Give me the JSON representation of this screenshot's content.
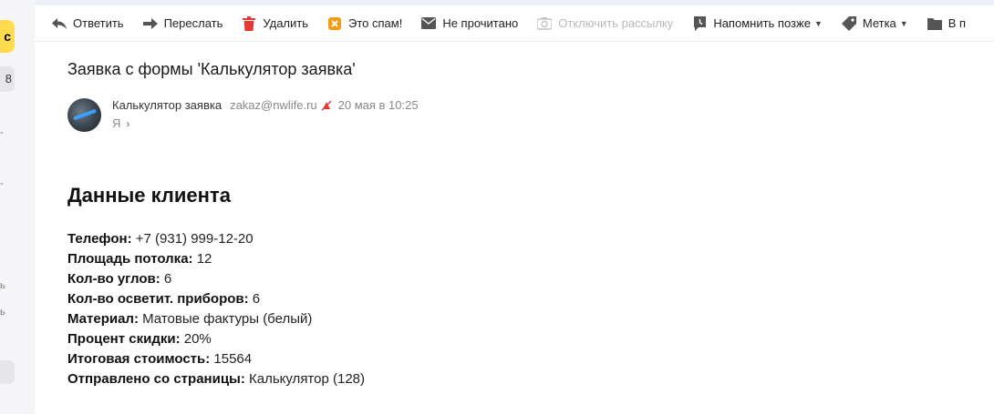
{
  "sidebar": {
    "compose_glyph": "с",
    "count": "8",
    "marks": [
      "-",
      "-",
      "ь",
      "ь"
    ]
  },
  "toolbar": {
    "items": [
      {
        "label": "Ответить",
        "icon": "reply-icon",
        "disabled": false
      },
      {
        "label": "Переслать",
        "icon": "forward-icon",
        "disabled": false
      },
      {
        "label": "Удалить",
        "icon": "trash-icon",
        "disabled": false
      },
      {
        "label": "Это спам!",
        "icon": "spam-icon",
        "disabled": false
      },
      {
        "label": "Не прочитано",
        "icon": "envelope-icon",
        "disabled": false
      },
      {
        "label": "Отключить рассылку",
        "icon": "unsubscribe-icon",
        "disabled": true
      },
      {
        "label": "Напомнить позже",
        "icon": "reminder-icon",
        "disabled": false,
        "dropdown": true
      },
      {
        "label": "Метка",
        "icon": "tag-icon",
        "disabled": false,
        "dropdown": true
      },
      {
        "label": "В п",
        "icon": "folder-icon",
        "disabled": false
      }
    ],
    "colors": {
      "trash": "#e53935",
      "spam": "#f39c12",
      "icon": "#555555"
    }
  },
  "message": {
    "subject": "Заявка с формы 'Калькулятор заявка'",
    "sender_name": "Калькулятор заявка",
    "sender_email": "zakaz@nwlife.ru",
    "date": "20 мая в 10:25",
    "recipient": "Я",
    "heading": "Данные клиента",
    "fields": [
      {
        "label": "Телефон:",
        "value": " +7 (931) 999-12-20"
      },
      {
        "label": "Площадь потолка:",
        "value": " 12"
      },
      {
        "label": "Кол-во углов:",
        "value": " 6"
      },
      {
        "label": "Кол-во осветит. приборов:",
        "value": " 6"
      },
      {
        "label": "Материал:",
        "value": " Матовые фактуры (белый)"
      },
      {
        "label": "Процент скидки:",
        "value": " 20%"
      },
      {
        "label": "Итоговая стоимость:",
        "value": " 15564"
      },
      {
        "label": "Отправлено со страницы:",
        "value": " Калькулятор (128)"
      }
    ]
  }
}
